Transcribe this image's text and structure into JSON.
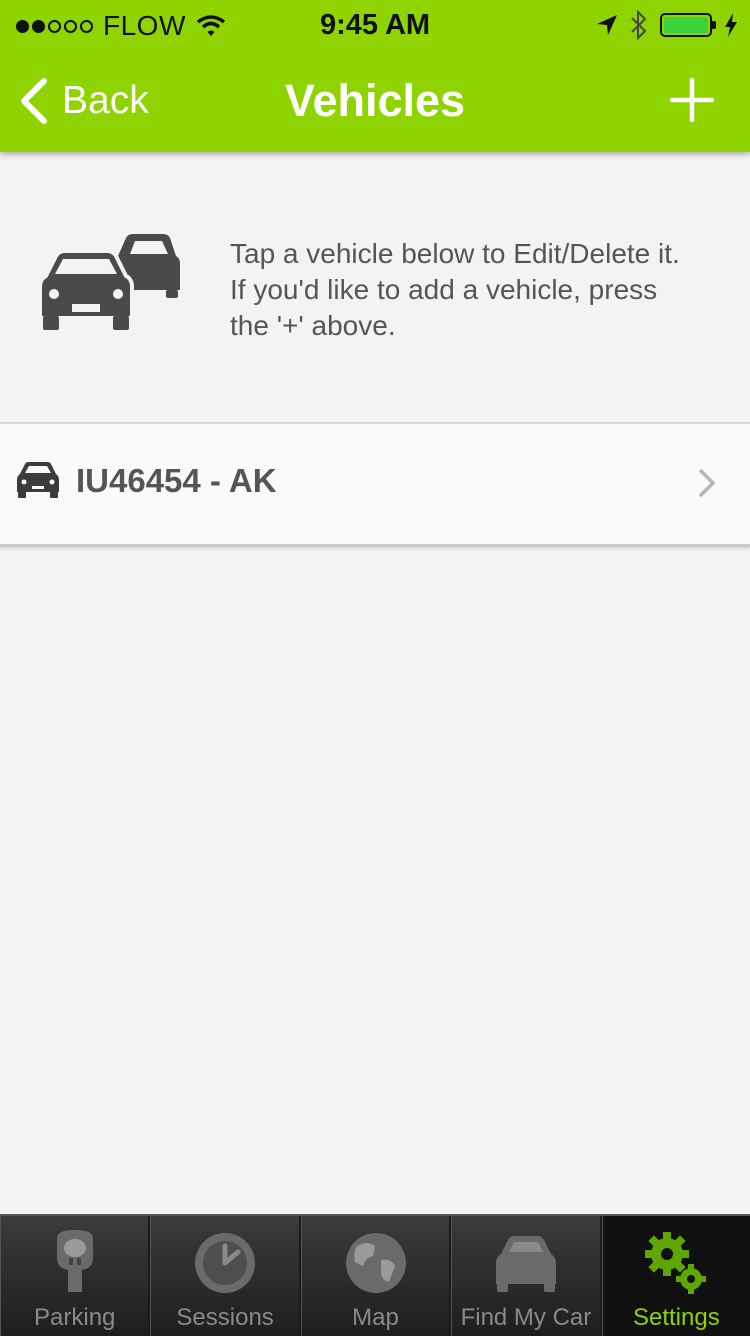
{
  "status_bar": {
    "carrier": "FLOW",
    "time": "9:45 AM"
  },
  "nav": {
    "back_label": "Back",
    "title": "Vehicles"
  },
  "info": {
    "line1": "Tap a vehicle below to Edit/Delete it.",
    "line2": "If you'd like to add a vehicle, press",
    "line3": "the '+' above."
  },
  "vehicles": [
    {
      "label": "IU46454 - AK"
    }
  ],
  "tabs": [
    {
      "label": "Parking",
      "icon": "parking-meter-icon"
    },
    {
      "label": "Sessions",
      "icon": "clock-icon"
    },
    {
      "label": "Map",
      "icon": "globe-icon"
    },
    {
      "label": "Find My Car",
      "icon": "car-icon"
    },
    {
      "label": "Settings",
      "icon": "gears-icon",
      "active": true
    }
  ],
  "colors": {
    "accent": "#8fd400",
    "tab_bar": "#2a2a2a",
    "text_gray": "#555555"
  }
}
